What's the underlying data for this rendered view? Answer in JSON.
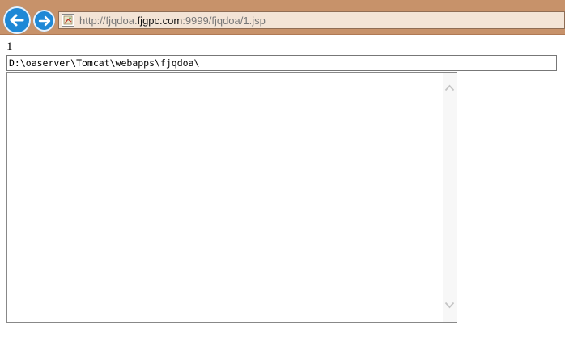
{
  "browser": {
    "url_prefix": "http://fjqdoa.",
    "url_domain": "fjgpc.com",
    "url_suffix": ":9999/fjqdoa/1.jsp",
    "accent_color": "#1e88d6",
    "toolbar_color": "#c7926a"
  },
  "page": {
    "number_text": "1",
    "path_value": "D:\\oaserver\\Tomcat\\webapps\\fjqdoa\\",
    "textarea_value": ""
  },
  "icons": {
    "back": "arrow-left-icon",
    "forward": "arrow-right-icon",
    "favicon": "broken-page-icon",
    "scroll_up": "chevron-up-icon",
    "scroll_down": "chevron-down-icon"
  }
}
